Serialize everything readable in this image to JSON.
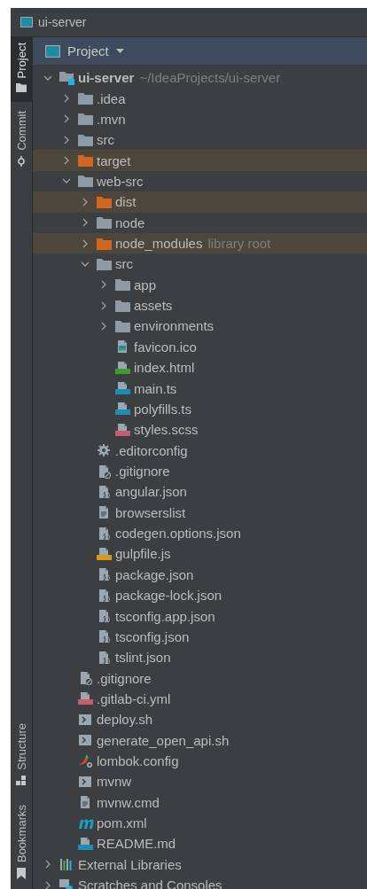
{
  "window": {
    "title": "ui-server"
  },
  "tool_strip": {
    "top": [
      {
        "label": "Project",
        "selected": true,
        "kind": "folder"
      },
      {
        "label": "Commit",
        "selected": false,
        "kind": "commit"
      }
    ],
    "bottom": [
      {
        "label": "Structure",
        "selected": false,
        "kind": "structure"
      },
      {
        "label": "Bookmarks",
        "selected": false,
        "kind": "bookmark"
      }
    ]
  },
  "panel": {
    "title": "Project"
  },
  "tree": [
    {
      "name": "ui-server",
      "hint": "~/IdeaProjects/ui-server",
      "kind": "module",
      "expanded": true,
      "excluded": false,
      "children": [
        {
          "name": ".idea",
          "kind": "folder",
          "expanded": false,
          "excluded": false
        },
        {
          "name": ".mvn",
          "kind": "folder",
          "expanded": false,
          "excluded": false
        },
        {
          "name": "src",
          "kind": "folder",
          "expanded": false,
          "excluded": false
        },
        {
          "name": "target",
          "kind": "folder",
          "expanded": false,
          "excluded": true
        },
        {
          "name": "web-src",
          "kind": "folder",
          "expanded": true,
          "excluded": false,
          "children": [
            {
              "name": "dist",
              "kind": "folder",
              "expanded": false,
              "excluded": true
            },
            {
              "name": "node",
              "kind": "folder",
              "expanded": false,
              "excluded": false
            },
            {
              "name": "node_modules",
              "hint": "library root",
              "kind": "folder",
              "expanded": false,
              "excluded": true
            },
            {
              "name": "src",
              "kind": "folder",
              "expanded": true,
              "excluded": false,
              "children": [
                {
                  "name": "app",
                  "kind": "folder",
                  "expanded": false,
                  "excluded": false
                },
                {
                  "name": "assets",
                  "kind": "folder",
                  "expanded": false,
                  "excluded": false
                },
                {
                  "name": "environments",
                  "kind": "folder",
                  "expanded": false,
                  "excluded": false
                },
                {
                  "name": "favicon.ico",
                  "kind": "image",
                  "excluded": false
                },
                {
                  "name": "index.html",
                  "kind": "html",
                  "excluded": false
                },
                {
                  "name": "main.ts",
                  "kind": "ts",
                  "excluded": false
                },
                {
                  "name": "polyfills.ts",
                  "kind": "ts",
                  "excluded": false
                },
                {
                  "name": "styles.scss",
                  "kind": "sass",
                  "excluded": false
                }
              ]
            },
            {
              "name": ".editorconfig",
              "kind": "gear",
              "excluded": false
            },
            {
              "name": ".gitignore",
              "kind": "ignore",
              "excluded": false
            },
            {
              "name": "angular.json",
              "kind": "json",
              "excluded": false
            },
            {
              "name": "browserslist",
              "kind": "text",
              "excluded": false
            },
            {
              "name": "codegen.options.json",
              "kind": "json",
              "excluded": false
            },
            {
              "name": "gulpfile.js",
              "kind": "js",
              "excluded": false
            },
            {
              "name": "package.json",
              "kind": "json",
              "excluded": false
            },
            {
              "name": "package-lock.json",
              "kind": "json",
              "excluded": false
            },
            {
              "name": "tsconfig.app.json",
              "kind": "json",
              "excluded": false
            },
            {
              "name": "tsconfig.json",
              "kind": "json",
              "excluded": false
            },
            {
              "name": "tslint.json",
              "kind": "json",
              "excluded": false
            }
          ]
        },
        {
          "name": ".gitignore",
          "kind": "ignore",
          "excluded": false
        },
        {
          "name": ".gitlab-ci.yml",
          "kind": "yml",
          "excluded": false
        },
        {
          "name": "deploy.sh",
          "kind": "shell",
          "excluded": false
        },
        {
          "name": "generate_open_api.sh",
          "kind": "shell",
          "excluded": false
        },
        {
          "name": "lombok.config",
          "kind": "lombok",
          "excluded": false
        },
        {
          "name": "mvnw",
          "kind": "shell",
          "excluded": false
        },
        {
          "name": "mvnw.cmd",
          "kind": "text",
          "excluded": false
        },
        {
          "name": "pom.xml",
          "kind": "maven",
          "excluded": false
        },
        {
          "name": "README.md",
          "kind": "md",
          "excluded": false
        }
      ]
    },
    {
      "name": "External Libraries",
      "kind": "libraries",
      "expanded": false,
      "excluded": false
    },
    {
      "name": "Scratches and Consoles",
      "kind": "scratches",
      "expanded": false,
      "excluded": false
    }
  ]
}
